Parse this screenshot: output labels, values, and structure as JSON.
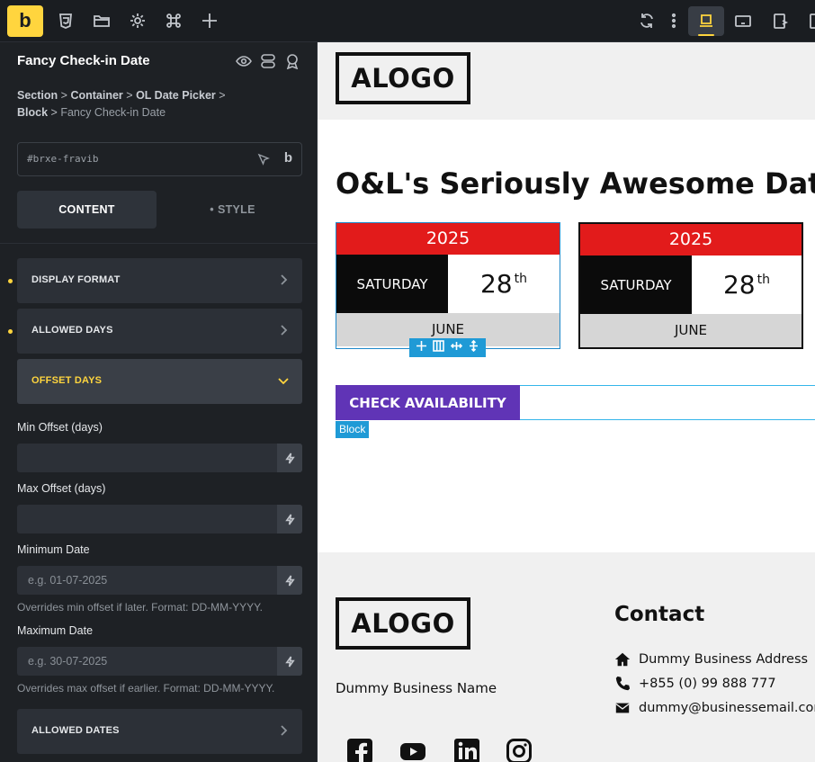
{
  "toolbar": {
    "logo": "b",
    "icons": [
      "css3-icon",
      "folder-icon",
      "settings-gear-icon",
      "command-icon",
      "plus-icon",
      "refresh-icon",
      "more-vertical-icon",
      "laptop-icon",
      "tablet-landscape-icon",
      "tablet-portrait-icon",
      "mobile-icon"
    ]
  },
  "panel": {
    "title": "Fancy Check-in Date",
    "breadcrumb": {
      "items": [
        "Section",
        "Container",
        "OL Date Picker",
        "Block"
      ],
      "separator": ">",
      "current": "Fancy Check-in Date"
    },
    "css_id": "#brxe-fravib",
    "tabs": {
      "content": "CONTENT",
      "style": "STYLE"
    },
    "accordions": {
      "display_format": "DISPLAY FORMAT",
      "allowed_days": "ALLOWED DAYS",
      "offset_days": "OFFSET DAYS",
      "allowed_dates": "ALLOWED DATES"
    },
    "fields": {
      "min_offset": {
        "label": "Min Offset (days)",
        "placeholder": ""
      },
      "max_offset": {
        "label": "Max Offset (days)",
        "placeholder": ""
      },
      "min_date": {
        "label": "Minimum Date",
        "placeholder": "e.g. 01-07-2025",
        "hint": "Overrides min offset if later. Format: DD-MM-YYYY."
      },
      "max_date": {
        "label": "Maximum Date",
        "placeholder": "e.g. 30-07-2025",
        "hint": "Overrides max offset if earlier. Format: DD-MM-YYYY."
      }
    }
  },
  "canvas": {
    "logo_text": "ALOGO",
    "heading": "O&L's Seriously Awesome Datepic",
    "datepickers": [
      {
        "year": "2025",
        "weekday": "SATURDAY",
        "day": "28",
        "suffix": "th",
        "month": "JUNE"
      },
      {
        "year": "2025",
        "weekday": "SATURDAY",
        "day": "28",
        "suffix": "th",
        "month": "JUNE"
      }
    ],
    "button": "CHECK AVAILABILITY",
    "block_tag": "Block",
    "footer": {
      "logo_text": "ALOGO",
      "business_name": "Dummy Business Name",
      "contact_heading": "Contact",
      "address": "Dummy Business Address",
      "phone": "+855 (0) 99 888 777",
      "email": "dummy@businessemail.com"
    }
  },
  "colors": {
    "accent": "#ffd53e",
    "year_bar": "#e21b1b",
    "button": "#6034b6",
    "selection": "#1f9ad6"
  }
}
